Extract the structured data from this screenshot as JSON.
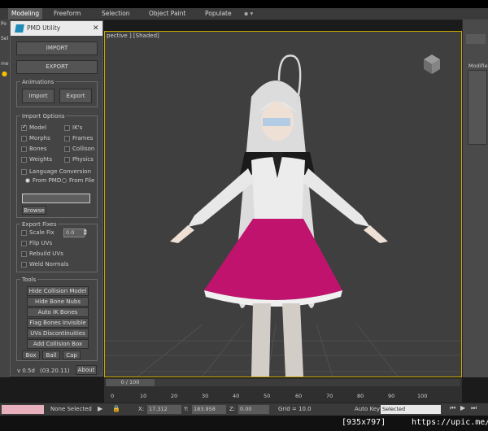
{
  "menu": {
    "tabs": [
      {
        "label": "Modeling",
        "active": true
      },
      {
        "label": "Freeform"
      },
      {
        "label": "Selection"
      },
      {
        "label": "Object Paint"
      },
      {
        "label": "Populate"
      }
    ],
    "left_labels": [
      "Po",
      "Sel",
      "me"
    ]
  },
  "viewport": {
    "label": "pective ] [Shaded]",
    "background": "#3f3f3f",
    "active_border": "#c9a600"
  },
  "right_panel": {
    "modifier_label": "Modifie"
  },
  "pmd": {
    "title": "PMD Utility",
    "import_button": "IMPORT",
    "export_button": "EXPORT",
    "animations": {
      "title": "Animations",
      "import": "Import",
      "export": "Export"
    },
    "import_options": {
      "title": "Import Options",
      "checkboxes_left": [
        {
          "label": "Model",
          "checked": true
        },
        {
          "label": "Morphs",
          "checked": false
        },
        {
          "label": "Bones",
          "checked": false
        },
        {
          "label": "Weights",
          "checked": false
        }
      ],
      "checkboxes_right": [
        {
          "label": "IK's",
          "checked": false
        },
        {
          "label": "Frames",
          "checked": false
        },
        {
          "label": "Collison",
          "checked": false
        },
        {
          "label": "Physics",
          "checked": false
        }
      ],
      "language_conversion": "Language Conversion",
      "from_pmd": "From PMD",
      "from_file": "From File",
      "browse": "Browse"
    },
    "export_fixes": {
      "title": "Export Fixes",
      "scale_fix": "Scale Fix",
      "scale_value": "0.0",
      "flip_uvs": "Flip UVs",
      "rebuild_uvs": "Rebuild UVs",
      "weld_normals": "Weld Normals"
    },
    "tools": {
      "title": "Tools",
      "buttons": [
        "Hide Collision Model",
        "Hide Bone Nubs",
        "Auto IK Bones",
        "Flag Bones Invisible",
        "UVs Discontinuities",
        "Add Collision Box"
      ],
      "small_buttons": [
        "Box",
        "Ball",
        "Cap"
      ]
    },
    "version": "v 0.5d",
    "date": "(03.20.11)",
    "about": "About"
  },
  "timeline": {
    "frame_label": "0 / 100",
    "ticks": [
      "0",
      "10",
      "20",
      "30",
      "40",
      "50",
      "60",
      "70",
      "80",
      "90",
      "100"
    ]
  },
  "status": {
    "none_selected": "None Selected",
    "x_label": "X:",
    "x_value": "17.312",
    "y_label": "Y:",
    "y_value": "183.958",
    "z_label": "Z:",
    "z_value": "0.00",
    "grid": "Grid = 10.0",
    "auto_key": "Auto Key",
    "selected": "Selected"
  },
  "footer": {
    "dimensions": "[935x797]",
    "site": "https://upic.me/"
  }
}
